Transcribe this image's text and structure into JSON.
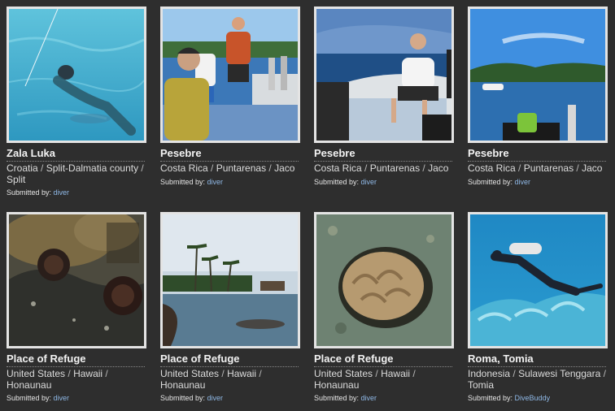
{
  "submitted_prefix": "Submitted by:",
  "cards": [
    {
      "title": "Zala Luka",
      "location": [
        "Croatia",
        "Split-Dalmatia county",
        "Split"
      ],
      "submitter": "diver",
      "photo": "underwater-snorkeler-icon"
    },
    {
      "title": "Pesebre",
      "location": [
        "Costa Rica",
        "Puntarenas",
        "Jaco"
      ],
      "submitter": "diver",
      "photo": "divers-on-boat-icon"
    },
    {
      "title": "Pesebre",
      "location": [
        "Costa Rica",
        "Puntarenas",
        "Jaco"
      ],
      "submitter": "diver",
      "photo": "man-on-boat-icon"
    },
    {
      "title": "Pesebre",
      "location": [
        "Costa Rica",
        "Puntarenas",
        "Jaco"
      ],
      "submitter": "diver",
      "photo": "bay-with-boat-icon"
    },
    {
      "title": "Place of Refuge",
      "location": [
        "United States",
        "Hawaii",
        "Honaunau"
      ],
      "submitter": "diver",
      "photo": "sea-urchins-icon"
    },
    {
      "title": "Place of Refuge",
      "location": [
        "United States",
        "Hawaii",
        "Honaunau"
      ],
      "submitter": "diver",
      "photo": "palm-shoreline-icon"
    },
    {
      "title": "Place of Refuge",
      "location": [
        "United States",
        "Hawaii",
        "Honaunau"
      ],
      "submitter": "diver",
      "photo": "coral-icon"
    },
    {
      "title": "Roma, Tomia",
      "location": [
        "Indonesia",
        "Sulawesi Tenggara",
        "Tomia"
      ],
      "submitter": "DiveBuddy",
      "photo": "scuba-diver-coral-icon"
    }
  ]
}
